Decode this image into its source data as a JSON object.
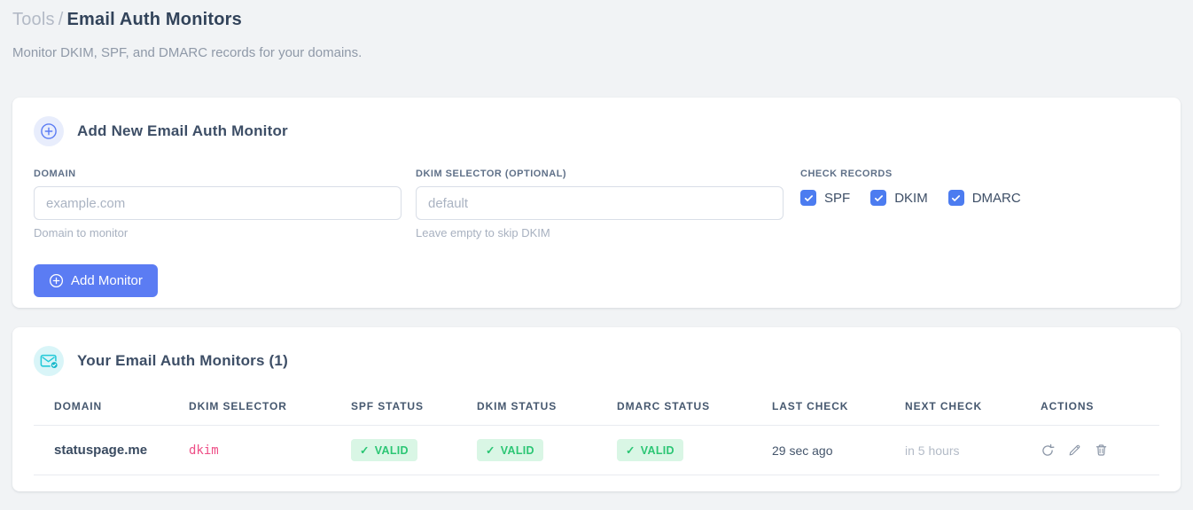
{
  "breadcrumb": {
    "section": "Tools",
    "separator": "/",
    "page": "Email Auth Monitors"
  },
  "subtitle": "Monitor DKIM, SPF, and DMARC records for your domains.",
  "icons": {
    "plus_circle": "plus-in-circle",
    "envelope_check": "envelope-with-check-badge",
    "check_glyph": "✓"
  },
  "add_card": {
    "title": "Add New Email Auth Monitor",
    "fields": {
      "domain": {
        "label": "DOMAIN",
        "value": "",
        "placeholder": "example.com",
        "helper": "Domain to monitor"
      },
      "dkim_selector": {
        "label": "DKIM SELECTOR (OPTIONAL)",
        "value": "",
        "placeholder": "default",
        "helper": "Leave empty to skip DKIM"
      }
    },
    "check_records": {
      "label": "CHECK RECORDS",
      "options": [
        {
          "label": "SPF",
          "checked": true
        },
        {
          "label": "DKIM",
          "checked": true
        },
        {
          "label": "DMARC",
          "checked": true
        }
      ]
    },
    "submit_label": "Add Monitor"
  },
  "monitors_card": {
    "title": "Your Email Auth Monitors (1)",
    "count": "1",
    "table": {
      "headers": [
        "DOMAIN",
        "DKIM SELECTOR",
        "SPF STATUS",
        "DKIM STATUS",
        "DMARC STATUS",
        "LAST CHECK",
        "NEXT CHECK",
        "ACTIONS"
      ],
      "rows": [
        {
          "domain": "statuspage.me",
          "dkim_selector": "dkim",
          "spf_status": "VALID",
          "dkim_status": "VALID",
          "dmarc_status": "VALID",
          "last_check": "29 sec ago",
          "next_check": "in 5 hours"
        }
      ]
    }
  },
  "colors": {
    "accent_blue": "#5b7cf3",
    "checkbox_blue": "#4c7cf0",
    "valid_bg": "#d9f6e5",
    "valid_text": "#2bc674",
    "code_pink": "#ee4e86",
    "icon_teal": "#22c9d8",
    "page_bg": "#f1f3f5"
  }
}
